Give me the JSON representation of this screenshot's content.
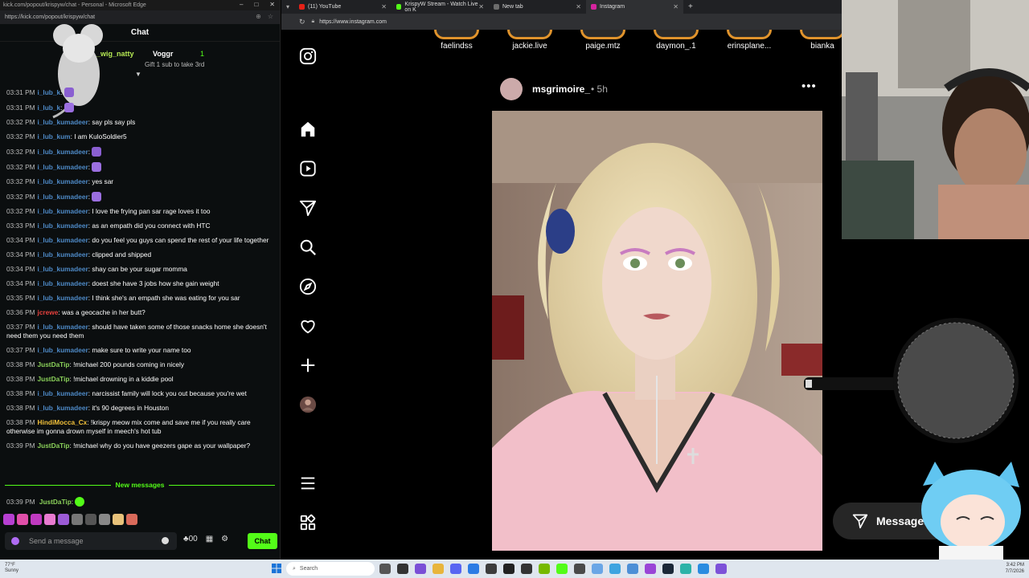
{
  "chat_window": {
    "title": "kick.com/popout/krispyw/chat - Personal - Microsoft Edge",
    "url": "https://kick.com/popout/krispyw/chat",
    "header": "Chat",
    "pinned": {
      "left_user": "_wig_natty",
      "gifter": "Voggr",
      "count": "1",
      "note": "Gift 1 sub to take 3rd"
    },
    "messages": [
      {
        "time": "03:31 PM",
        "user": "i_lub_k",
        "color": "blue",
        "text": ""
      },
      {
        "time": "03:31 PM",
        "user": "i_lub_k",
        "color": "blue",
        "text": ""
      },
      {
        "time": "03:32 PM",
        "user": "i_lub_kumadeer",
        "color": "blue",
        "text": "say pls say pls"
      },
      {
        "time": "03:32 PM",
        "user": "i_lub_kum",
        "color": "blue",
        "text": "I am KuloSoldier5"
      },
      {
        "time": "03:32 PM",
        "user": "i_lub_kumadeer",
        "color": "blue",
        "text": ""
      },
      {
        "time": "03:32 PM",
        "user": "i_lub_kumadeer",
        "color": "blue",
        "text": ""
      },
      {
        "time": "03:32 PM",
        "user": "i_lub_kumadeer",
        "color": "blue",
        "text": "yes sar"
      },
      {
        "time": "03:32 PM",
        "user": "i_lub_kumadeer",
        "color": "blue",
        "text": ""
      },
      {
        "time": "03:32 PM",
        "user": "i_lub_kumadeer",
        "color": "blue",
        "text": "I love the frying pan sar rage loves it too"
      },
      {
        "time": "03:33 PM",
        "user": "i_lub_kumadeer",
        "color": "blue",
        "text": "as an empath did you connect with HTC"
      },
      {
        "time": "03:34 PM",
        "user": "i_lub_kumadeer",
        "color": "blue",
        "text": "do you feel you guys can spend the rest of your life together"
      },
      {
        "time": "03:34 PM",
        "user": "i_lub_kumadeer",
        "color": "blue",
        "text": "clipped and shipped"
      },
      {
        "time": "03:34 PM",
        "user": "i_lub_kumadeer",
        "color": "blue",
        "text": "shay can be your sugar momma"
      },
      {
        "time": "03:34 PM",
        "user": "i_lub_kumadeer",
        "color": "blue",
        "text": "doest she have 3 jobs how she gain weight"
      },
      {
        "time": "03:35 PM",
        "user": "i_lub_kumadeer",
        "color": "blue",
        "text": "I think she's an empath she was eating for you sar"
      },
      {
        "time": "03:36 PM",
        "user": "jcrewe",
        "color": "red",
        "text": "was a geocache in her butt?"
      },
      {
        "time": "03:37 PM",
        "user": "i_lub_kumadeer",
        "color": "blue",
        "text": "should have taken some of those snacks home she doesn't need them you need them"
      },
      {
        "time": "03:37 PM",
        "user": "i_lub_kumadeer",
        "color": "blue",
        "text": "make sure to write your name too"
      },
      {
        "time": "03:38 PM",
        "user": "JustDaTip",
        "color": "green",
        "text": "!michael 200 pounds coming in nicely"
      },
      {
        "time": "03:38 PM",
        "user": "JustDaTip",
        "color": "green",
        "text": "!michael drowning in a kiddie pool"
      },
      {
        "time": "03:38 PM",
        "user": "i_lub_kumadeer",
        "color": "blue",
        "text": "narcissist family will lock you out because you're wet"
      },
      {
        "time": "03:38 PM",
        "user": "i_lub_kumadeer",
        "color": "blue",
        "text": "it's 90 degrees in Houston"
      },
      {
        "time": "03:38 PM",
        "user": "HindiMocca_Cx",
        "color": "yellow",
        "text": "!krispy meow mix come and save me if you really care otherwise im gonna drown myself in meech's hot tub"
      },
      {
        "time": "03:39 PM",
        "user": "JustDaTip",
        "color": "green",
        "text": "!michael why do you have geezers gape as your wallpaper?"
      }
    ],
    "new_messages_label": "New messages",
    "last_message": {
      "time": "03:39 PM",
      "user": "JustDaTip",
      "text": ""
    },
    "input_placeholder": "Send a message",
    "send_label": "Chat",
    "viewer_count": "00"
  },
  "browser": {
    "tabs": [
      {
        "label": "(11) YouTube",
        "color": "#e62117"
      },
      {
        "label": "KrispyW Stream - Watch Live on K",
        "color": "#53fc18"
      },
      {
        "label": "New tab",
        "color": "#6c6c6c"
      },
      {
        "label": "Instagram",
        "color": "#d6249f"
      }
    ],
    "url": "https://www.instagram.com"
  },
  "instagram": {
    "stories": [
      "faelindss",
      "jackie.live",
      "paige.mtz",
      "daymon_.1",
      "erinsplane...",
      "bianka"
    ],
    "post": {
      "username": "msgrimoire_",
      "time": "• 5h",
      "more": "•••"
    },
    "messages_label": "Messages",
    "nav_icons": [
      "instagram-logo-icon",
      "home-icon",
      "reels-icon",
      "direct-icon",
      "search-icon",
      "explore-icon",
      "heart-icon",
      "create-icon",
      "profile-icon",
      "menu-icon",
      "more-apps-icon"
    ]
  },
  "taskbar": {
    "weather_temp": "77°F",
    "weather_desc": "Sunny",
    "search_placeholder": "Search",
    "clock_time": "3:42 PM",
    "clock_date": "7/7/2026"
  }
}
